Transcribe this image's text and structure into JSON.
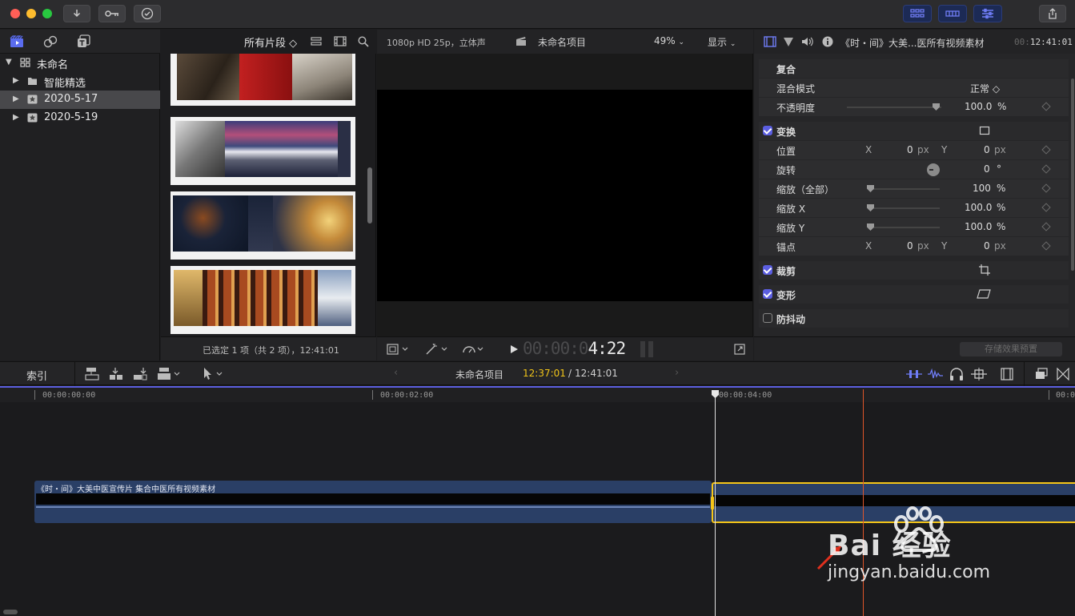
{
  "toolbar": {
    "buttons": [
      "import-icon",
      "keyword-icon",
      "checkmark-icon"
    ],
    "right_buttons": [
      "layout-grid-icon",
      "browser-view-icon",
      "inspector-toggle-icon",
      "share-icon"
    ]
  },
  "library": {
    "icons": [
      "libraries-icon",
      "photos-icon",
      "titles-icon"
    ],
    "root": "未命名",
    "items": [
      {
        "label": "智能精选",
        "icon": "folder-icon"
      },
      {
        "label": "2020-5-17",
        "icon": "event-star-icon"
      },
      {
        "label": "2020-5-19",
        "icon": "event-star-icon"
      }
    ]
  },
  "browser": {
    "filter_label": "所有片段 ◇",
    "status": "已选定 1 项（共 2 项），12:41:01"
  },
  "viewer": {
    "format": "1080p HD 25p，立体声",
    "project": "未命名项目",
    "zoom": "49%",
    "display": "显示",
    "timecode_dim": "00:00:0",
    "timecode_bright": "4:22"
  },
  "inspector": {
    "title": "《时・间》大美...医所有视频素材",
    "duration_dim": "00:",
    "duration": "12:41:01",
    "rows": {
      "composite": "复合",
      "blend_mode": "混合模式",
      "blend_value": "正常 ◇",
      "opacity": "不透明度",
      "opacity_value": "100.0",
      "opacity_unit": "%",
      "transform": "变换",
      "position": "位置",
      "pos_x_label": "X",
      "pos_x": "0",
      "pos_x_unit": "px",
      "pos_y_label": "Y",
      "pos_y": "0",
      "pos_y_unit": "px",
      "rotation": "旋转",
      "rotation_value": "0",
      "rotation_unit": "°",
      "scale_all": "缩放（全部）",
      "scale_all_value": "100",
      "scale_all_unit": "%",
      "scale_x": "缩放 X",
      "scale_x_value": "100.0",
      "scale_x_unit": "%",
      "scale_y": "缩放 Y",
      "scale_y_value": "100.0",
      "scale_y_unit": "%",
      "anchor": "锚点",
      "anchor_x_label": "X",
      "anchor_x": "0",
      "anchor_x_unit": "px",
      "anchor_y_label": "Y",
      "anchor_y": "0",
      "anchor_y_unit": "px",
      "crop": "裁剪",
      "distort": "变形",
      "stabilize": "防抖动"
    },
    "save_preset": "存储效果预置"
  },
  "timeline_bar": {
    "index": "索引",
    "project": "未命名项目",
    "position": "12:37:01",
    "separator": "/",
    "duration": "12:41:01"
  },
  "timeline": {
    "ruler": [
      "00:00:00:00",
      "00:00:02:00",
      "00:00:04:00",
      "00:0"
    ],
    "clip_name": "《时・间》大美中医宣传片 集合中医所有视频素材"
  },
  "watermark": {
    "brand": "Bai 经验",
    "url": "jingyan.baidu.com"
  },
  "colors": {
    "accent": "#5b5ee0",
    "clip": "#2a3f66",
    "selection": "#f5c518",
    "playhead_skimmer": "#e0562a",
    "timecode": "#f0c419"
  }
}
